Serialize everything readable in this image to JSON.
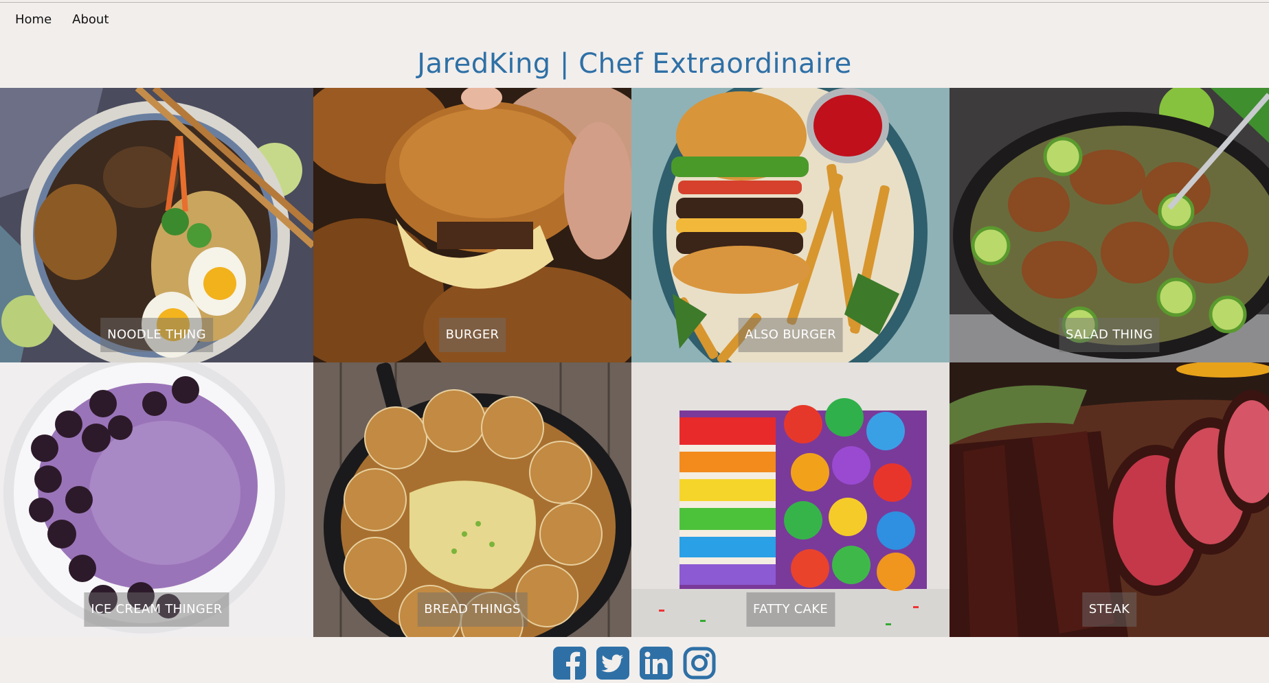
{
  "nav": {
    "home_label": "Home",
    "about_label": "About"
  },
  "header": {
    "title": "JaredKing | Chef Extraordinaire"
  },
  "gallery": {
    "items": [
      {
        "label": "NOODLE THING",
        "icon": "noodle-bowl-photo"
      },
      {
        "label": "BURGER",
        "icon": "sliders-photo"
      },
      {
        "label": "ALSO BURGER",
        "icon": "burger-fries-photo"
      },
      {
        "label": "SALAD THING",
        "icon": "chicken-skillet-photo"
      },
      {
        "label": "ICE CREAM THINGER",
        "icon": "ice-cream-photo"
      },
      {
        "label": "BREAD THINGS",
        "icon": "bread-skillet-photo"
      },
      {
        "label": "FATTY CAKE",
        "icon": "rainbow-cake-photo"
      },
      {
        "label": "STEAK",
        "icon": "steak-photo"
      }
    ]
  },
  "footer": {
    "social": [
      "facebook-icon",
      "twitter-icon",
      "linkedin-icon",
      "instagram-icon"
    ]
  },
  "colors": {
    "accent": "#2e70a6",
    "background": "#f2eeec",
    "social_blue": "#2e70a6"
  }
}
